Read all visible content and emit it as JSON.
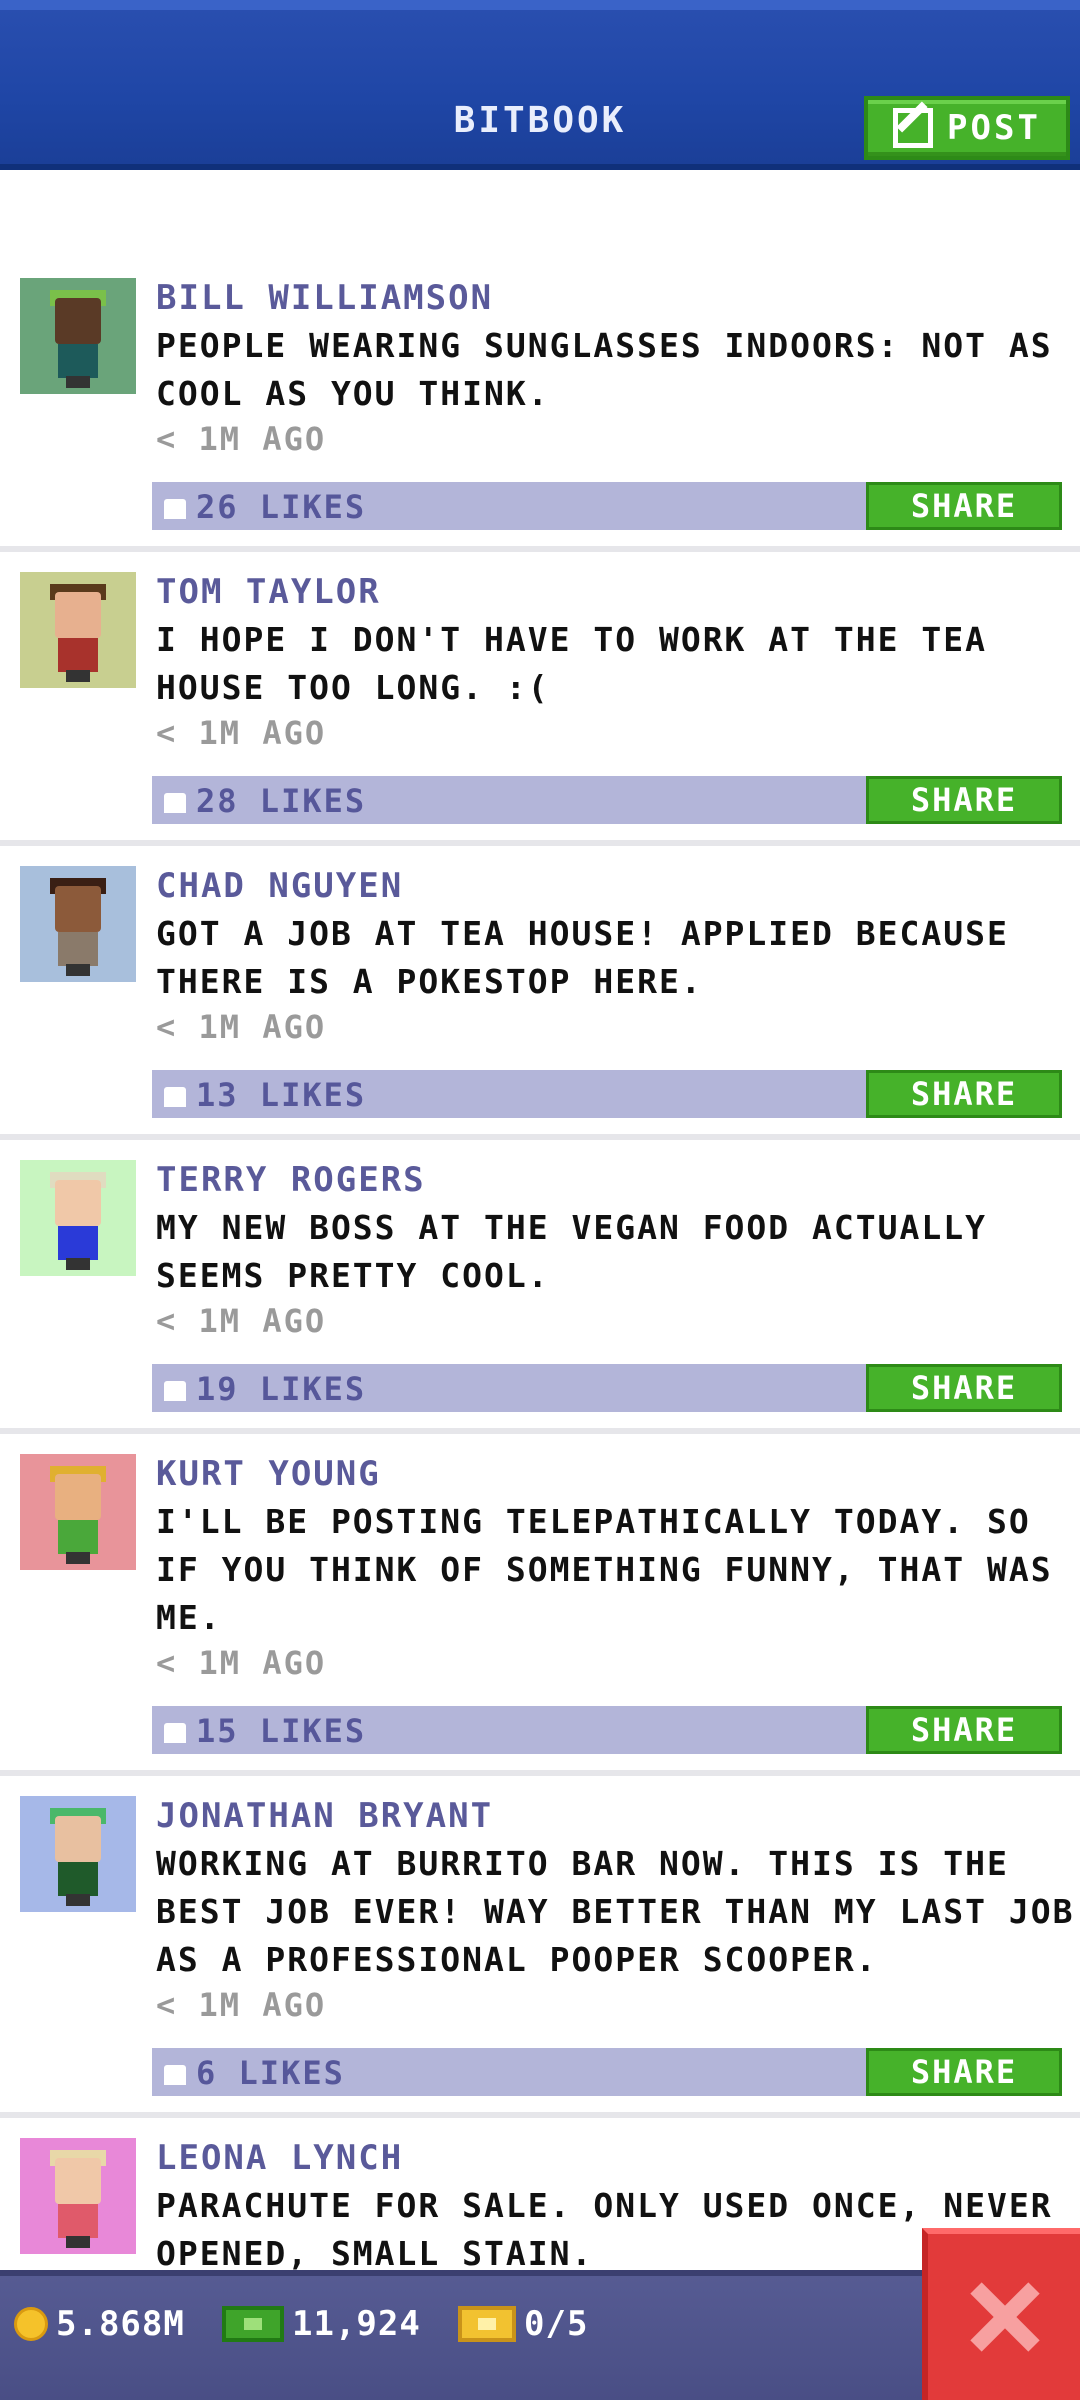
{
  "header": {
    "title": "BITBOOK",
    "post_label": "POST"
  },
  "posts": [
    {
      "name": "BILL WILLIAMSON",
      "text": "PEOPLE WEARING SUNGLASSES INDOORS: NOT AS COOL AS YOU THINK.",
      "time": "< 1M AGO",
      "likes": "26 LIKES",
      "share": "SHARE",
      "avatar_bg": "#6aa47a",
      "hat": "#7ac04a",
      "skin": "#5a3a26",
      "shirt": "#1d5a5a"
    },
    {
      "name": "TOM TAYLOR",
      "text": "I HOPE I DON'T HAVE TO WORK AT THE TEA HOUSE TOO LONG. :(",
      "time": "< 1M AGO",
      "likes": "28 LIKES",
      "share": "SHARE",
      "avatar_bg": "#c8cf90",
      "hat": "#5a3a1c",
      "skin": "#e7b08f",
      "shirt": "#a8322c"
    },
    {
      "name": "CHAD NGUYEN",
      "text": "GOT A JOB AT TEA HOUSE! APPLIED BECAUSE THERE IS A POKESTOP HERE.",
      "time": "< 1M AGO",
      "likes": "13 LIKES",
      "share": "SHARE",
      "avatar_bg": "#a8bfdc",
      "hat": "#3a1f14",
      "skin": "#8c5a3a",
      "shirt": "#8a7a6a"
    },
    {
      "name": "TERRY ROGERS",
      "text": "MY NEW BOSS AT THE VEGAN FOOD ACTUALLY SEEMS PRETTY COOL.",
      "time": "< 1M AGO",
      "likes": "19 LIKES",
      "share": "SHARE",
      "avatar_bg": "#c8f5c0",
      "hat": "#e0dcc0",
      "skin": "#f0c8a8",
      "shirt": "#2a3ad8"
    },
    {
      "name": "KURT YOUNG",
      "text": "I'LL BE POSTING TELEPATHICALLY TODAY. SO IF YOU THINK OF SOMETHING FUNNY, THAT WAS ME.",
      "time": "< 1M AGO",
      "likes": "15 LIKES",
      "share": "SHARE",
      "avatar_bg": "#e8949a",
      "hat": "#e0b030",
      "skin": "#e8b080",
      "shirt": "#4aa83a"
    },
    {
      "name": "JONATHAN BRYANT",
      "text": "WORKING AT BURRITO BAR NOW. THIS IS THE BEST JOB EVER! WAY BETTER THAN MY LAST JOB AS A PROFESSIONAL POOPER SCOOPER.",
      "time": "< 1M AGO",
      "likes": "6 LIKES",
      "share": "SHARE",
      "avatar_bg": "#a6b8e8",
      "hat": "#4ab86a",
      "skin": "#e8c0a0",
      "shirt": "#1f5a2a"
    },
    {
      "name": "LEONA LYNCH",
      "text": "PARACHUTE FOR SALE. ONLY USED ONCE, NEVER OPENED, SMALL STAIN.",
      "time": "",
      "likes": "",
      "share": "",
      "avatar_bg": "#e888d8",
      "hat": "#e8d8a8",
      "skin": "#f0c8a8",
      "shirt": "#e05a6a"
    }
  ],
  "status": {
    "coins": "5.868M",
    "cash": "11,924",
    "tickets": "0/5"
  }
}
